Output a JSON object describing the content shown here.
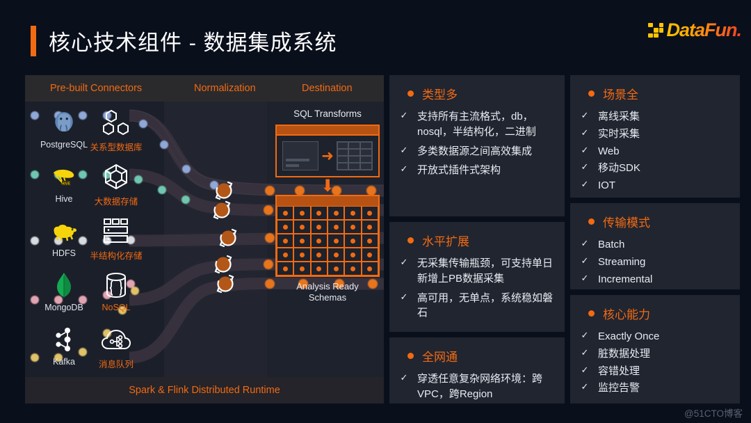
{
  "header": {
    "title": "核心技术组件 - 数据集成系统",
    "logo_text": "DataFun.",
    "accent_color": "#f26a12"
  },
  "diagram": {
    "col_headers": {
      "connectors": "Pre-built Connectors",
      "normalization": "Normalization",
      "destination": "Destination"
    },
    "footer": "Spark & Flink Distributed Runtime",
    "connectors_left": [
      {
        "label": "PostgreSQL",
        "icon": "postgresql-icon"
      },
      {
        "label": "Hive",
        "icon": "hive-icon"
      },
      {
        "label": "HDFS",
        "icon": "hadoop-icon"
      },
      {
        "label": "MongoDB",
        "icon": "mongodb-icon"
      },
      {
        "label": "Kafka",
        "icon": "kafka-icon"
      }
    ],
    "connectors_right": [
      {
        "label": "关系型数据库",
        "icon": "hexagon-nodes-icon"
      },
      {
        "label": "大数据存储",
        "icon": "polyhedron-icon"
      },
      {
        "label": "半结构化存储",
        "icon": "server-rack-icon"
      },
      {
        "label": "NoSQL",
        "icon": "database-braces-icon"
      },
      {
        "label": "消息队列",
        "icon": "cloud-nodes-icon"
      }
    ],
    "destination": {
      "sql_title": "SQL Transforms",
      "caption_line1": "Analysis Ready",
      "caption_line2": "Schemas",
      "schema_cols": 6,
      "schema_rows": 5
    },
    "pipe_colors": [
      "#8fa8d8",
      "#6fc7b0",
      "#d8dbe0",
      "#e3a4b2",
      "#e0c268"
    ],
    "transformed_color": "#e8741a"
  },
  "cards": {
    "mid": [
      {
        "title": "类型多",
        "items": [
          "支持所有主流格式，db，nosql，半结构化，二进制",
          "多类数据源之间高效集成",
          "开放式插件式架构"
        ]
      },
      {
        "title": "水平扩展",
        "items": [
          "无采集传输瓶颈，可支持单日新增上PB数据采集",
          "高可用，无单点，系统稳如磐石"
        ]
      },
      {
        "title": "全网通",
        "items": [
          "穿透任意复杂网络环境：跨VPC，跨Region"
        ]
      }
    ],
    "right": [
      {
        "title": "场景全",
        "items": [
          "离线采集",
          "实时采集",
          "Web",
          "移动SDK",
          "IOT"
        ]
      },
      {
        "title": "传输模式",
        "items": [
          "Batch",
          "Streaming",
          "Incremental"
        ]
      },
      {
        "title": "核心能力",
        "items": [
          "Exactly Once",
          "脏数据处理",
          "容错处理",
          "监控告警"
        ]
      }
    ],
    "tick_glyph": "✓"
  },
  "watermark": "@51CTO博客"
}
